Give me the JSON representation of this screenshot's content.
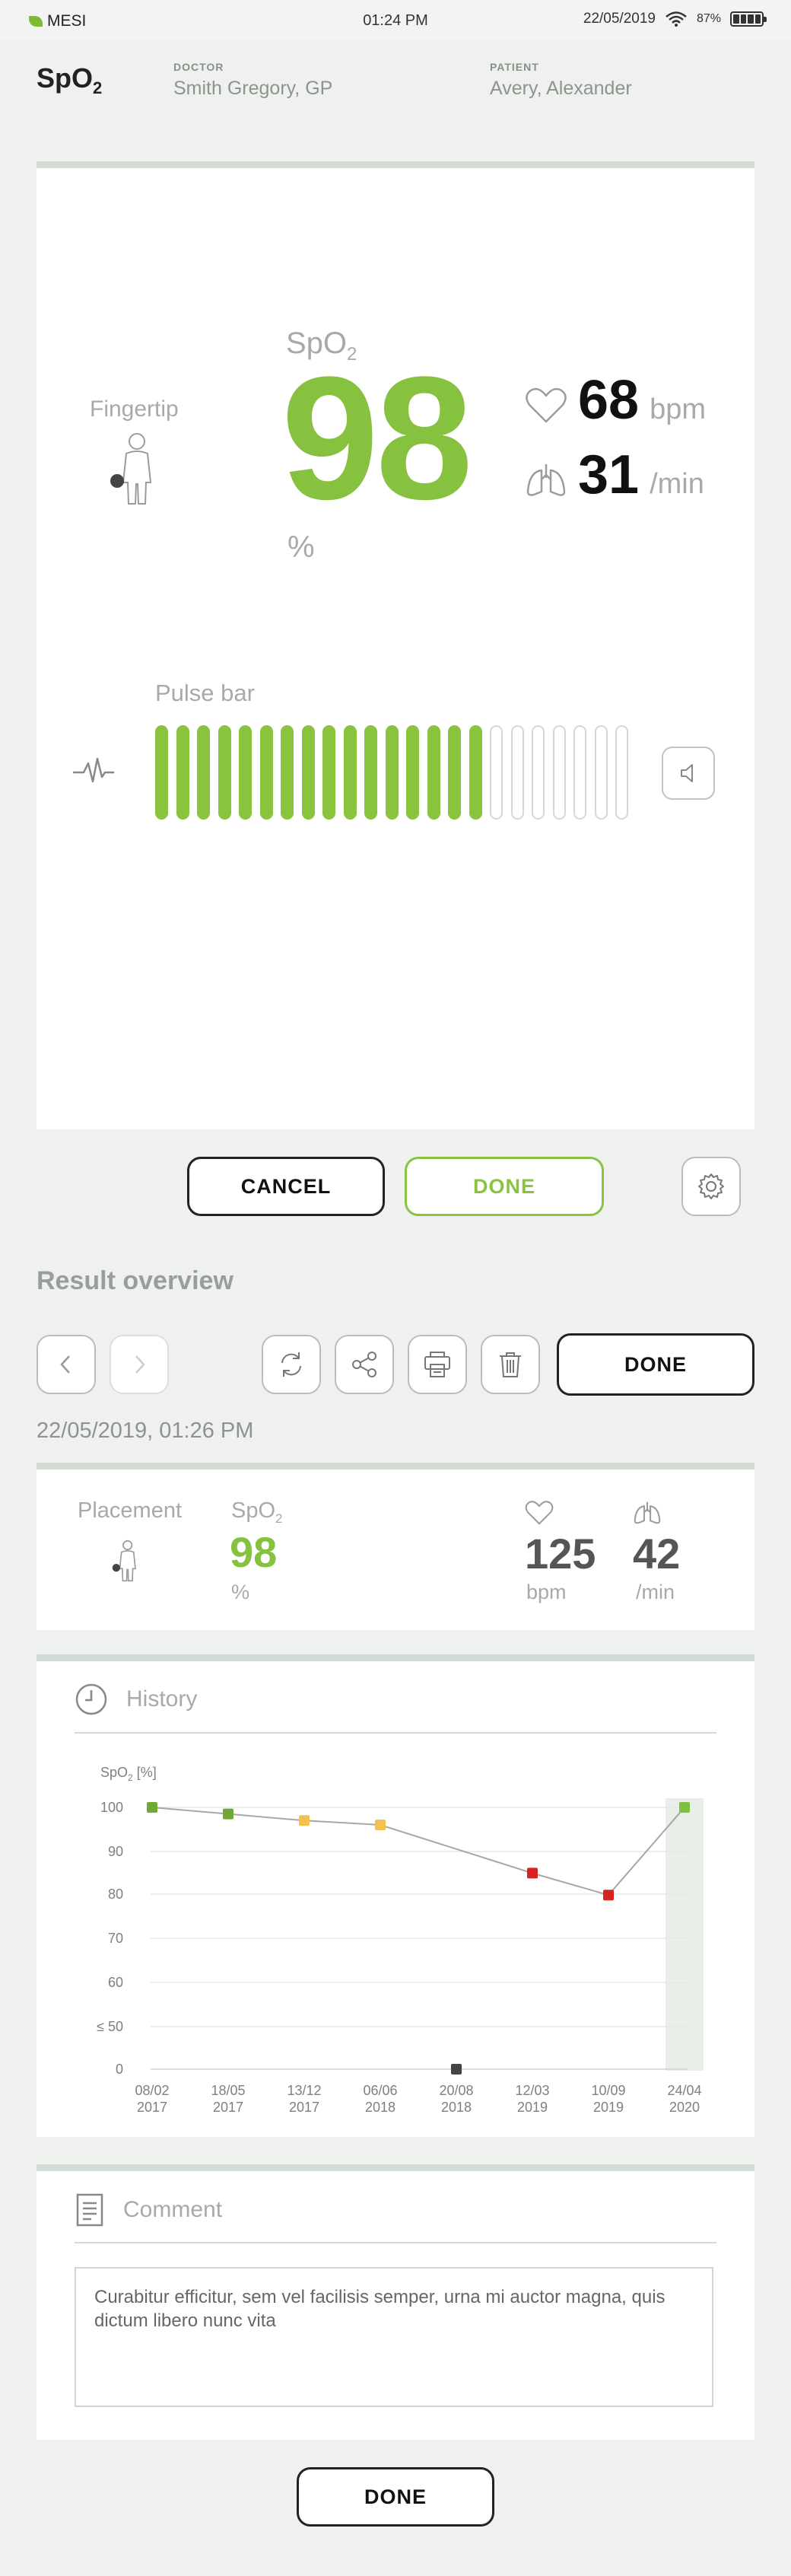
{
  "status_bar": {
    "carrier": "MESI",
    "time": "01:24 PM",
    "date": "22/05/2019",
    "battery": "87%"
  },
  "header": {
    "title_main": "SpO",
    "title_sub": "2",
    "doctor_label": "DOCTOR",
    "doctor_name": "Smith Gregory, GP",
    "patient_label": "PATIENT",
    "patient_name": "Avery, Alexander"
  },
  "measurement": {
    "spo2_label_main": "SpO",
    "spo2_label_sub": "2",
    "spo2_value": "98",
    "spo2_unit": "%",
    "placement_label": "Fingertip",
    "pulse_value": "68",
    "pulse_unit": "bpm",
    "resp_value": "31",
    "resp_unit": "/min",
    "pulse_bar_label": "Pulse bar",
    "pulse_bar_total": 23,
    "pulse_bar_active": 16
  },
  "actions": {
    "cancel_label": "CANCEL",
    "done_label": "DONE"
  },
  "result_overview": {
    "title": "Result overview",
    "done_label": "DONE",
    "timestamp": "22/05/2019, 01:26 PM",
    "placement_label": "Placement",
    "spo2_label_main": "SpO",
    "spo2_label_sub": "2",
    "spo2_value": "98",
    "spo2_unit": "%",
    "pulse_value": "125",
    "pulse_unit": "bpm",
    "resp_value": "42",
    "resp_unit": "/min"
  },
  "history": {
    "title": "History"
  },
  "chart_data": {
    "type": "line",
    "ylabel_main": "SpO",
    "ylabel_sub": "2",
    "ylabel_suffix": " [%]",
    "y_ticks": [
      "100",
      "90",
      "80",
      "70",
      "60",
      "≤ 50",
      "0"
    ],
    "categories": [
      [
        "08/02",
        "2017"
      ],
      [
        "18/05",
        "2017"
      ],
      [
        "13/12",
        "2017"
      ],
      [
        "06/06",
        "2018"
      ],
      [
        "20/08",
        "2018"
      ],
      [
        "12/03",
        "2019"
      ],
      [
        "10/09",
        "2019"
      ],
      [
        "24/04",
        "2020"
      ]
    ],
    "points": [
      {
        "x": 0,
        "y": 100,
        "color": "#6fa832"
      },
      {
        "x": 1,
        "y": 98.5,
        "color": "#6fa832"
      },
      {
        "x": 2,
        "y": 97,
        "color": "#f2c14e"
      },
      {
        "x": 3,
        "y": 96,
        "color": "#f2c14e"
      },
      {
        "x": 4,
        "y": 0,
        "color": "#444444"
      },
      {
        "x": 5,
        "y": 85,
        "color": "#d82222"
      },
      {
        "x": 6,
        "y": 80,
        "color": "#d82222"
      },
      {
        "x": 7,
        "y": 100,
        "color": "#7dc143"
      }
    ],
    "line_skip_index": 4,
    "highlight_index": 7,
    "grid": true
  },
  "comment": {
    "title": "Comment",
    "text": "Curabitur efficitur, sem vel facilisis semper, urna mi auctor magna, quis dictum libero nunc vita"
  },
  "footer": {
    "done_label": "DONE"
  }
}
